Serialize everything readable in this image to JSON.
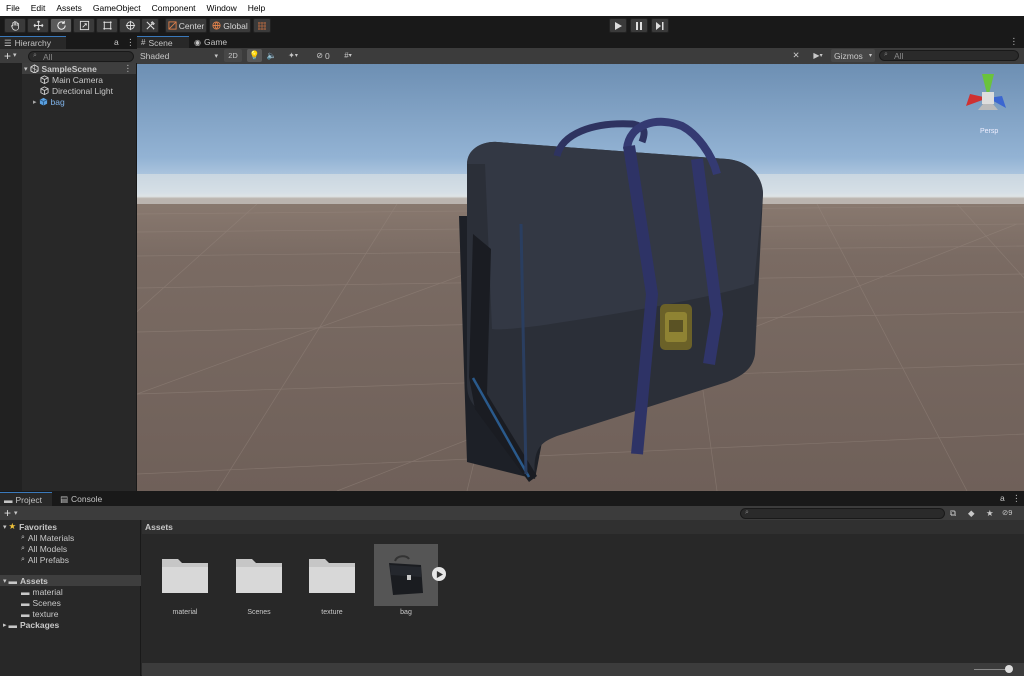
{
  "menu": [
    "File",
    "Edit",
    "Assets",
    "GameObject",
    "Component",
    "Window",
    "Help"
  ],
  "toolbar": {
    "pivot": "Center",
    "space": "Global"
  },
  "hierarchy": {
    "tab": "Hierarchy",
    "search": "All",
    "scene": "SampleScene",
    "items": [
      {
        "label": "Main Camera",
        "icon": "gameobject-icon"
      },
      {
        "label": "Directional Light",
        "icon": "gameobject-icon"
      },
      {
        "label": "bag",
        "icon": "prefab-icon"
      }
    ]
  },
  "scene": {
    "tabs": [
      "Scene",
      "Game"
    ],
    "shading": "Shaded",
    "mode2d": "2D",
    "hidden_count": "0",
    "gizmos": "Gizmos",
    "search": "All",
    "projection": "Persp"
  },
  "project": {
    "tabs": [
      "Project",
      "Console"
    ],
    "hidden_count": "9",
    "breadcrumb": "Assets",
    "favorites": {
      "label": "Favorites",
      "items": [
        "All Materials",
        "All Models",
        "All Prefabs"
      ]
    },
    "assets_tree": {
      "label": "Assets",
      "items": [
        "material",
        "Scenes",
        "texture"
      ]
    },
    "packages": "Packages",
    "grid": [
      {
        "label": "material",
        "kind": "folder"
      },
      {
        "label": "Scenes",
        "kind": "folder"
      },
      {
        "label": "texture",
        "kind": "folder"
      },
      {
        "label": "bag",
        "kind": "model"
      }
    ]
  },
  "colors": {
    "accent": "#3a79bb",
    "selection": "#2c5d87",
    "panel": "#282828"
  }
}
